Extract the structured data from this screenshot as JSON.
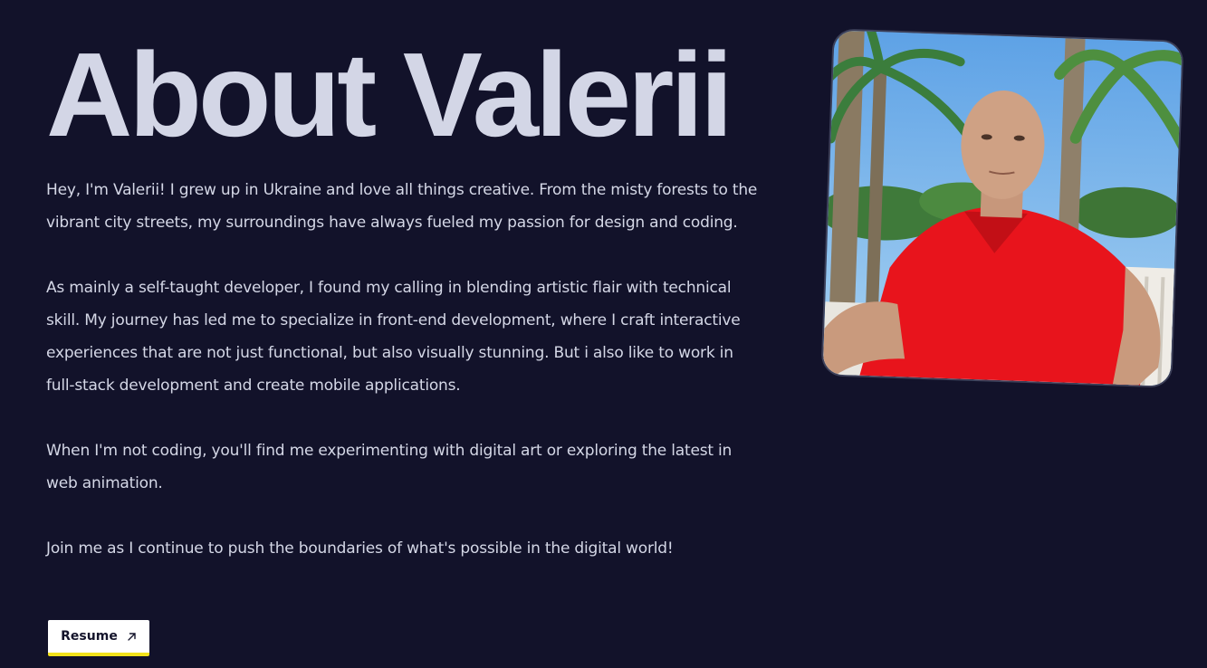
{
  "about": {
    "title": "About Valerii",
    "paragraphs": [
      "Hey, I'm Valerii! I grew up in Ukraine and love all things creative. From the misty forests to the vibrant city streets, my surroundings have always fueled my passion for design and coding.",
      "As mainly a self-taught developer, I found my calling in blending artistic flair with technical skill. My journey has led me to specialize in front-end development, where I craft interactive experiences that are not just functional, but also visually stunning. But i also like to work in full-stack development and create mobile applications.",
      "When I'm not coding, you'll find me experimenting with digital art or exploring the latest in web animation.",
      "Join me as I continue to push the boundaries of what's possible in the digital world!"
    ],
    "resume_label": "Resume",
    "resume_icon": "arrow-up-right-icon"
  },
  "colors": {
    "background": "#12122a",
    "heading": "#d3d6e6",
    "text": "#d4d7e6",
    "button_bg": "#ffffff",
    "button_accent": "#f2e21a",
    "shirt": "#e8141c"
  },
  "photo": {
    "subject": "portrait-photo",
    "description_icon": "portrait-photo"
  }
}
